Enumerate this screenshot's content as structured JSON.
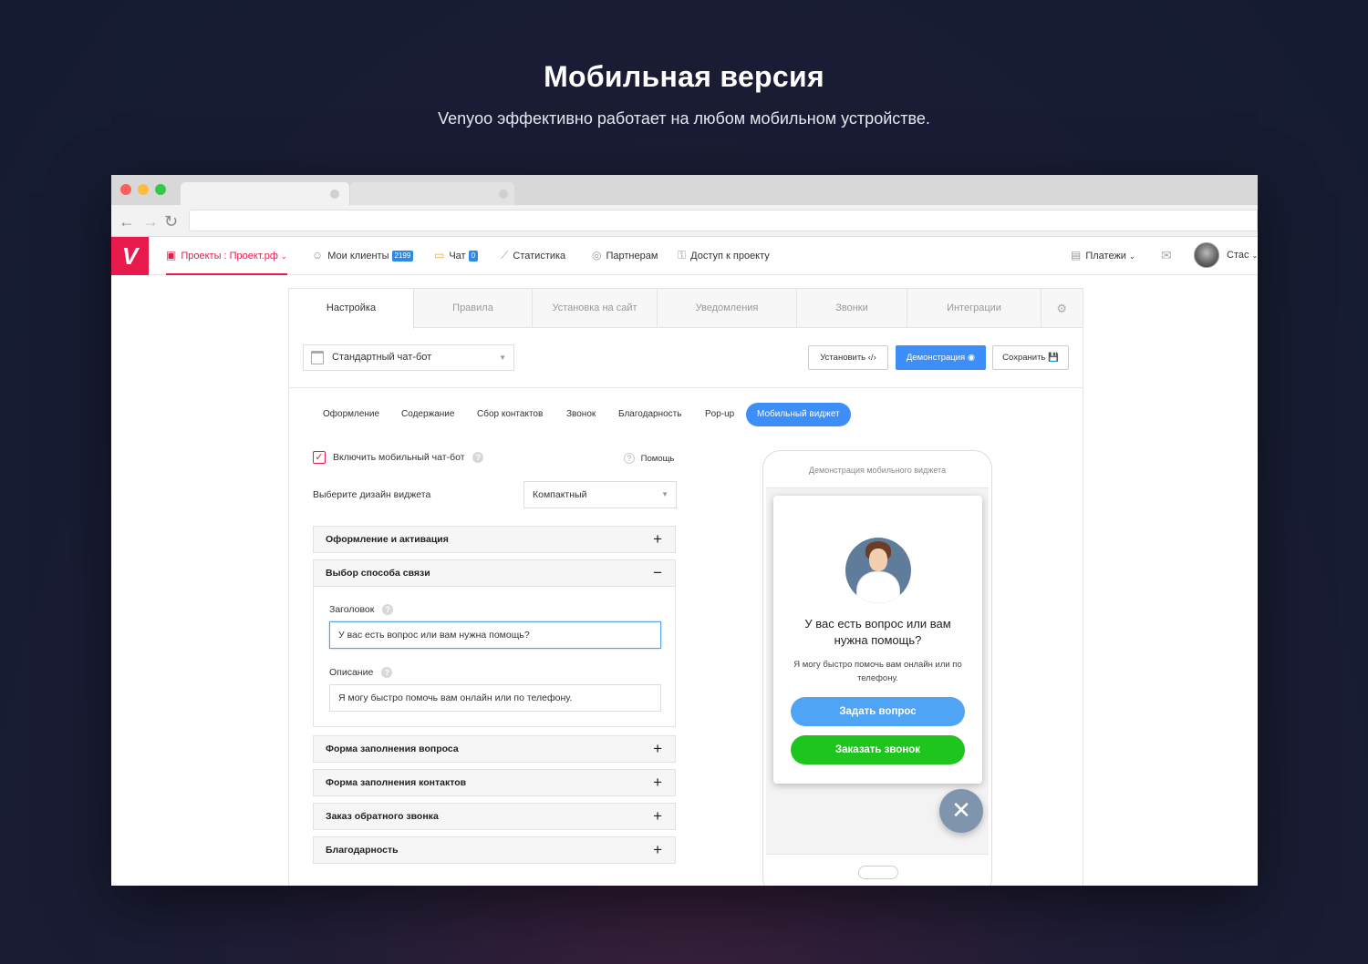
{
  "hero": {
    "title": "Мобильная версия",
    "subtitle": "Venyoo эффективно работает на любом мобильном устройстве."
  },
  "app": {
    "logo": "V",
    "nav": {
      "projects": "Проекты : Проект.рф",
      "clients": "Мои клиенты",
      "clients_badge": "2199",
      "chat": "Чат",
      "chat_badge": "0",
      "stats": "Статистика",
      "partners": "Партнерам",
      "access": "Доступ к проекту",
      "payments": "Платежи",
      "user": "Стас"
    },
    "tabs": [
      "Настройка",
      "Правила",
      "Установка на сайт",
      "Уведомления",
      "Звонки",
      "Интеграции"
    ],
    "bot_select": "Стандартный чат-бот",
    "buttons": {
      "install": "Установить ‹/›",
      "demo": "Демонстрация ◉",
      "save": "Сохранить 💾"
    },
    "subtabs": [
      "Оформление",
      "Содержание",
      "Сбор контактов",
      "Звонок",
      "Благодарность",
      "Pop-up",
      "Мобильный виджет"
    ],
    "enable_label": "Включить мобильный чат-бот",
    "help": "Помощь",
    "design_label": "Выберите дизайн виджета",
    "design_value": "Компактный",
    "accordions": {
      "a1": "Оформление и активация",
      "a2": "Выбор способа связи",
      "a3": "Форма заполнения вопроса",
      "a4": "Форма заполнения контактов",
      "a5": "Заказ обратного звонка",
      "a6": "Благодарность"
    },
    "form": {
      "heading_label": "Заголовок",
      "heading_value": "У вас есть вопрос или вам нужна помощь?",
      "desc_label": "Описание",
      "desc_value": "Я могу быстро помочь вам онлайн или по телефону."
    },
    "preview": {
      "title": "Демонстрация мобильного виджета",
      "heading": "У вас есть вопрос или вам нужна помощь?",
      "desc": "Я могу быстро помочь вам онлайн или по телефону.",
      "ask_btn": "Задать вопрос",
      "call_btn": "Заказать звонок"
    }
  },
  "colors": {
    "brand": "#e8194b",
    "accent": "#3d8ef8",
    "green": "#1fc51f"
  }
}
